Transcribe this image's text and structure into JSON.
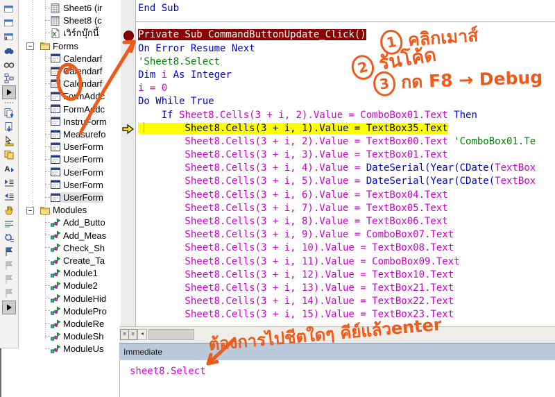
{
  "colors": {
    "keyword": "#0000c8",
    "identifier": "#cc00cc",
    "comment": "#008000",
    "breakpoint_bg": "#8b0000",
    "breakpoint_fg": "#ffffff",
    "current_bg": "#ffff00",
    "current_fg": "#000000",
    "annotation": "#ee5a1a",
    "immediate_titlebar": "#bcc9db",
    "margin_bg": "#ececec"
  },
  "left_toolbar": {
    "icons": [
      {
        "name": "window-top-partial-icon",
        "shape": "window"
      },
      {
        "name": "properties-window-icon",
        "shape": "window"
      },
      {
        "name": "window-alert-icon",
        "shape": "windowalert"
      },
      {
        "name": "find-icon",
        "shape": "find"
      },
      {
        "name": "quick-watch-icon",
        "shape": "glasses"
      },
      {
        "name": "call-stack-icon",
        "shape": "callstack"
      },
      {
        "name": "toolbar-options-icon",
        "shape": "pressed"
      },
      {
        "name": "toolbar-grip",
        "shape": "grip"
      },
      {
        "name": "copy-block-icon",
        "shape": "copyblock"
      },
      {
        "name": "export-file-icon",
        "shape": "exportfile"
      },
      {
        "name": "pointer-measure-icon",
        "shape": "pointerruler"
      },
      {
        "name": "copy-sheet-icon",
        "shape": "copysheet"
      },
      {
        "name": "font-tool-icon",
        "shape": "fontA"
      },
      {
        "name": "indent-icon",
        "shape": "indent"
      },
      {
        "name": "outdent-icon",
        "shape": "outdent"
      },
      {
        "name": "hand-tool-icon",
        "shape": "hand"
      },
      {
        "name": "list-lines-icon",
        "shape": "lines"
      },
      {
        "name": "undo-list-icon",
        "shape": "undolines"
      },
      {
        "name": "toggle-bookmark-icon",
        "shape": "flag"
      },
      {
        "name": "next-bookmark-icon",
        "shape": "flaggray"
      },
      {
        "name": "previous-bookmark-icon",
        "shape": "flaggray"
      },
      {
        "name": "clear-bookmarks-icon",
        "shape": "flaggray"
      },
      {
        "name": "toolbar-options-2-icon",
        "shape": "pressed"
      }
    ]
  },
  "project_tree": {
    "items": [
      {
        "icon": "sheet",
        "label": "Sheet6 (ir",
        "indent": 44,
        "conn": true
      },
      {
        "icon": "sheet",
        "label": "Sheet8 (c",
        "indent": 44,
        "conn": true
      },
      {
        "icon": "workbook",
        "label": "เวิร์กบุ๊กนี้",
        "indent": 44,
        "conn": true
      },
      {
        "icon": "folder",
        "label": "Forms",
        "indent": 29,
        "expander": true
      },
      {
        "icon": "form",
        "label": "Calendarf",
        "indent": 44,
        "conn": true
      },
      {
        "icon": "form",
        "label": "Calendarf",
        "indent": 44,
        "conn": true
      },
      {
        "icon": "form",
        "label": "Calendarf",
        "indent": 44,
        "conn": true
      },
      {
        "icon": "form",
        "label": "FormAddc",
        "indent": 44,
        "conn": true
      },
      {
        "icon": "form",
        "label": "FormAddc",
        "indent": 44,
        "conn": true
      },
      {
        "icon": "form",
        "label": "InstruForm",
        "indent": 44,
        "conn": true
      },
      {
        "icon": "form",
        "label": "Measurefo",
        "indent": 44,
        "conn": true
      },
      {
        "icon": "form",
        "label": "UserForm",
        "indent": 44,
        "conn": true
      },
      {
        "icon": "form",
        "label": "UserForm",
        "indent": 44,
        "conn": true
      },
      {
        "icon": "form",
        "label": "UserForm",
        "indent": 44,
        "conn": true
      },
      {
        "icon": "form",
        "label": "UserForm",
        "indent": 44,
        "conn": true
      },
      {
        "icon": "form",
        "label": "UserForm",
        "indent": 44,
        "conn": true,
        "selected": true
      },
      {
        "icon": "folder",
        "label": "Modules",
        "indent": 29,
        "expander": true
      },
      {
        "icon": "module",
        "label": "Add_Butto",
        "indent": 44,
        "conn": true
      },
      {
        "icon": "module",
        "label": "Add_Meas",
        "indent": 44,
        "conn": true
      },
      {
        "icon": "module",
        "label": "Check_Sh",
        "indent": 44,
        "conn": true
      },
      {
        "icon": "module",
        "label": "Create_Ta",
        "indent": 44,
        "conn": true
      },
      {
        "icon": "module",
        "label": "Module1",
        "indent": 44,
        "conn": true
      },
      {
        "icon": "module",
        "label": "Module2",
        "indent": 44,
        "conn": true
      },
      {
        "icon": "module",
        "label": "ModuleHid",
        "indent": 44,
        "conn": true
      },
      {
        "icon": "module",
        "label": "ModulePro",
        "indent": 44,
        "conn": true
      },
      {
        "icon": "module",
        "label": "ModuleRe",
        "indent": 44,
        "conn": true
      },
      {
        "icon": "module",
        "label": "ModuleSh",
        "indent": 44,
        "conn": true
      },
      {
        "icon": "module",
        "label": "ModuleUs",
        "indent": 44,
        "conn": true
      }
    ]
  },
  "code_editor": {
    "breakpoint_line_index": 2,
    "current_line_index": 9,
    "lines": [
      {
        "tokens": [
          [
            "kw",
            "End Sub"
          ]
        ]
      },
      {
        "tokens": []
      },
      {
        "bg": "bp",
        "tokens": [
          [
            "bp",
            "Private Sub CommandButtonUpdate_Click()"
          ]
        ]
      },
      {
        "tokens": [
          [
            "kw",
            "On Error Resume Next"
          ]
        ]
      },
      {
        "tokens": [
          [
            "cm",
            "'Sheet8.Select"
          ]
        ]
      },
      {
        "tokens": [
          [
            "kw",
            "Dim "
          ],
          [
            "id",
            "i"
          ],
          [
            "kw",
            " As Integer"
          ]
        ]
      },
      {
        "tokens": [
          [
            "id",
            "i = 0"
          ]
        ]
      },
      {
        "tokens": [
          [
            "kw",
            "Do While True"
          ]
        ]
      },
      {
        "tokens": [
          [
            "id",
            "    "
          ],
          [
            "kw",
            "If "
          ],
          [
            "id",
            "Sheet8.Cells(3 + i, 2).Value = ComboBox01.Text "
          ],
          [
            "kw",
            "Then"
          ]
        ]
      },
      {
        "bg": "cur",
        "tokens": [
          [
            "cur",
            "        Sheet8.Cells(3 + i, 1).Value = TextBox35.Text"
          ]
        ]
      },
      {
        "tokens": [
          [
            "id",
            "        Sheet8.Cells(3 + i, 2).Value = TextBox00.Text "
          ],
          [
            "cm",
            "'ComboBox01.Te"
          ]
        ]
      },
      {
        "tokens": [
          [
            "id",
            "        Sheet8.Cells(3 + i, 3).Value = TextBox01.Text"
          ]
        ]
      },
      {
        "tokens": [
          [
            "id",
            "        Sheet8.Cells(3 + i, 4).Value = "
          ],
          [
            "kw",
            "DateSerial(Year(CDate("
          ],
          [
            "id",
            "TextBox"
          ]
        ]
      },
      {
        "tokens": [
          [
            "id",
            "        Sheet8.Cells(3 + i, 5).Value = "
          ],
          [
            "kw",
            "DateSerial(Year(CDate("
          ],
          [
            "id",
            "TextBox"
          ]
        ]
      },
      {
        "tokens": [
          [
            "id",
            "        Sheet8.Cells(3 + i, 6).Value = TextBox04.Text"
          ]
        ]
      },
      {
        "tokens": [
          [
            "id",
            "        Sheet8.Cells(3 + i, 7).Value = TextBox05.Text"
          ]
        ]
      },
      {
        "tokens": [
          [
            "id",
            "        Sheet8.Cells(3 + i, 8).Value = TextBox06.Text"
          ]
        ]
      },
      {
        "tokens": [
          [
            "id",
            "        Sheet8.Cells(3 + i, 9).Value = ComboBox07.Text"
          ]
        ]
      },
      {
        "tokens": [
          [
            "id",
            "        Sheet8.Cells(3 + i, 10).Value = TextBox08.Text"
          ]
        ]
      },
      {
        "tokens": [
          [
            "id",
            "        Sheet8.Cells(3 + i, 11).Value = ComboBox09.Text"
          ]
        ]
      },
      {
        "tokens": [
          [
            "id",
            "        Sheet8.Cells(3 + i, 12).Value = TextBox10.Text"
          ]
        ]
      },
      {
        "tokens": [
          [
            "id",
            "        Sheet8.Cells(3 + i, 13).Value = TextBox21.Text"
          ]
        ]
      },
      {
        "tokens": [
          [
            "id",
            "        Sheet8.Cells(3 + i, 14).Value = TextBox22.Text"
          ]
        ]
      },
      {
        "tokens": [
          [
            "id",
            "        Sheet8.Cells(3 + i, 15).Value = TextBox23.Text"
          ]
        ]
      }
    ]
  },
  "immediate": {
    "title": "Immediate",
    "content": "sheet8.Select"
  },
  "annotations": {
    "step1": {
      "num": "1",
      "text": "คลิกเมาส์"
    },
    "step2": {
      "num": "2",
      "text": "รันโค้ด"
    },
    "step3": {
      "num": "3",
      "text": "กด F8 → Debug"
    },
    "note": {
      "text": "ต้องการไปชีตใดๆ คีย์แล้วenter"
    }
  }
}
